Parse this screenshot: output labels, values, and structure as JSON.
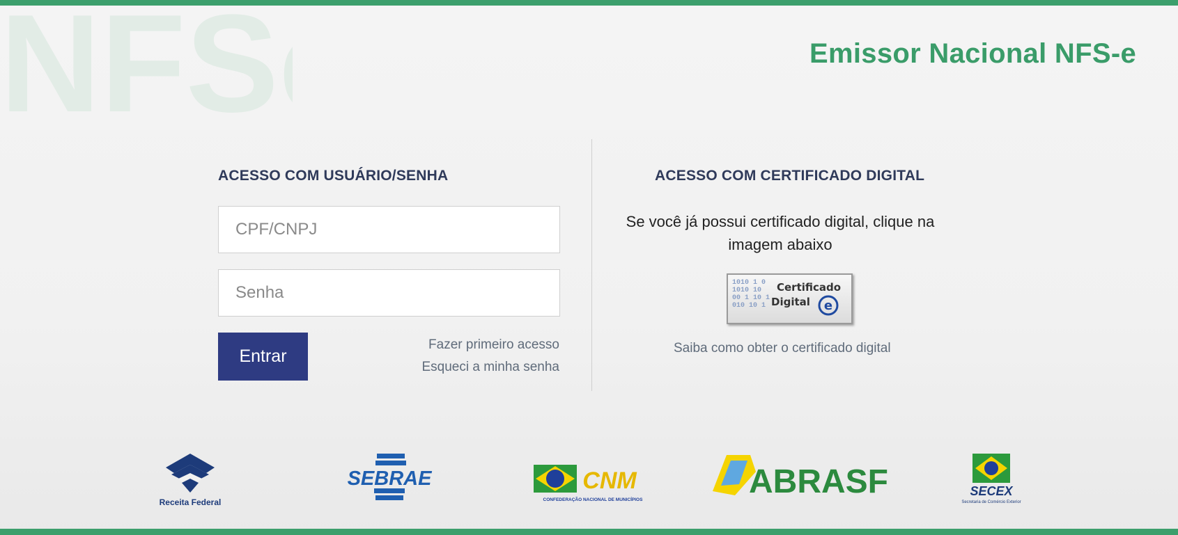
{
  "header": {
    "watermark_text": "NFSe",
    "title": "Emissor Nacional NFS-e"
  },
  "login": {
    "title": "ACESSO COM USUÁRIO/SENHA",
    "cpf_placeholder": "CPF/CNPJ",
    "senha_placeholder": "Senha",
    "submit_label": "Entrar",
    "first_access_link": "Fazer primeiro acesso",
    "forgot_password_link": "Esqueci a minha senha"
  },
  "certificate": {
    "title": "ACESSO COM CERTIFICADO DIGITAL",
    "instruction": "Se você já possui certificado digital, clique na imagem abaixo",
    "button_line1": "Certificado",
    "button_line2": "Digital",
    "info_link": "Saiba como obter o certificado digital"
  },
  "partners": {
    "receita_federal": "Receita Federal",
    "sebrae": "SEBRAE",
    "cnm": "CNM",
    "cnm_caption": "CONFEDERAÇÃO NACIONAL DE MUNICÍPIOS",
    "abrasf": "ABRASF",
    "secex": "SECEX",
    "secex_caption": "Secretaria de Comércio Exterior"
  },
  "colors": {
    "brand_green": "#3c9f6c",
    "button_blue": "#2e3b82",
    "title_dark": "#2f3a5a"
  }
}
